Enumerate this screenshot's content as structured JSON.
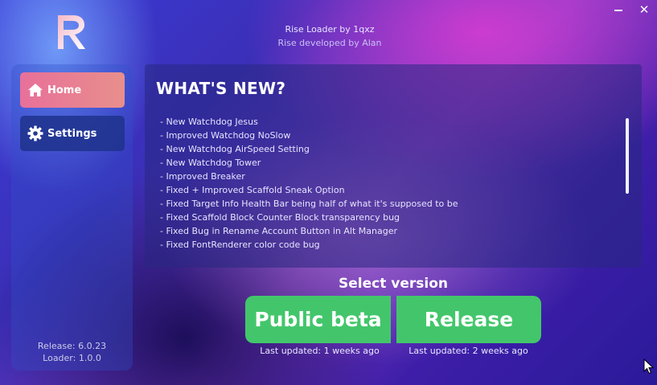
{
  "header": {
    "title": "Rise Loader by 1qxz",
    "subtitle": "Rise developed by Alan"
  },
  "window_controls": {
    "minimize_icon": "minimize-icon",
    "close_symbol": "✕"
  },
  "sidebar": {
    "items": [
      {
        "label": "Home",
        "icon": "home-icon",
        "active": true
      },
      {
        "label": "Settings",
        "icon": "gear-icon",
        "active": false
      }
    ],
    "release": "Release: 6.0.23",
    "loader": "Loader: 1.0.0"
  },
  "news": {
    "title": "WHAT'S NEW?",
    "items": [
      "- New Watchdog Jesus",
      "- Improved Watchdog NoSlow",
      "- New Watchdog AirSpeed Setting",
      "- New Watchdog Tower",
      "- Improved Breaker",
      "- Fixed + Improved Scaffold Sneak Option",
      "- Fixed Target Info Health Bar being half of what it's supposed to be",
      "- Fixed Scaffold Block Counter Block transparency bug",
      "- Fixed Bug in Rename Account Button in Alt Manager",
      "- Fixed FontRenderer color code bug"
    ]
  },
  "version_select": {
    "label": "Select version",
    "beta_label": "Public beta",
    "release_label": "Release",
    "beta_updated": "Last updated: 1 weeks  ago",
    "release_updated": "Last updated: 2 weeks  ago"
  },
  "colors": {
    "accent_green": "#43c66b",
    "home_active": "#e8709a",
    "panel": "#28288a"
  }
}
